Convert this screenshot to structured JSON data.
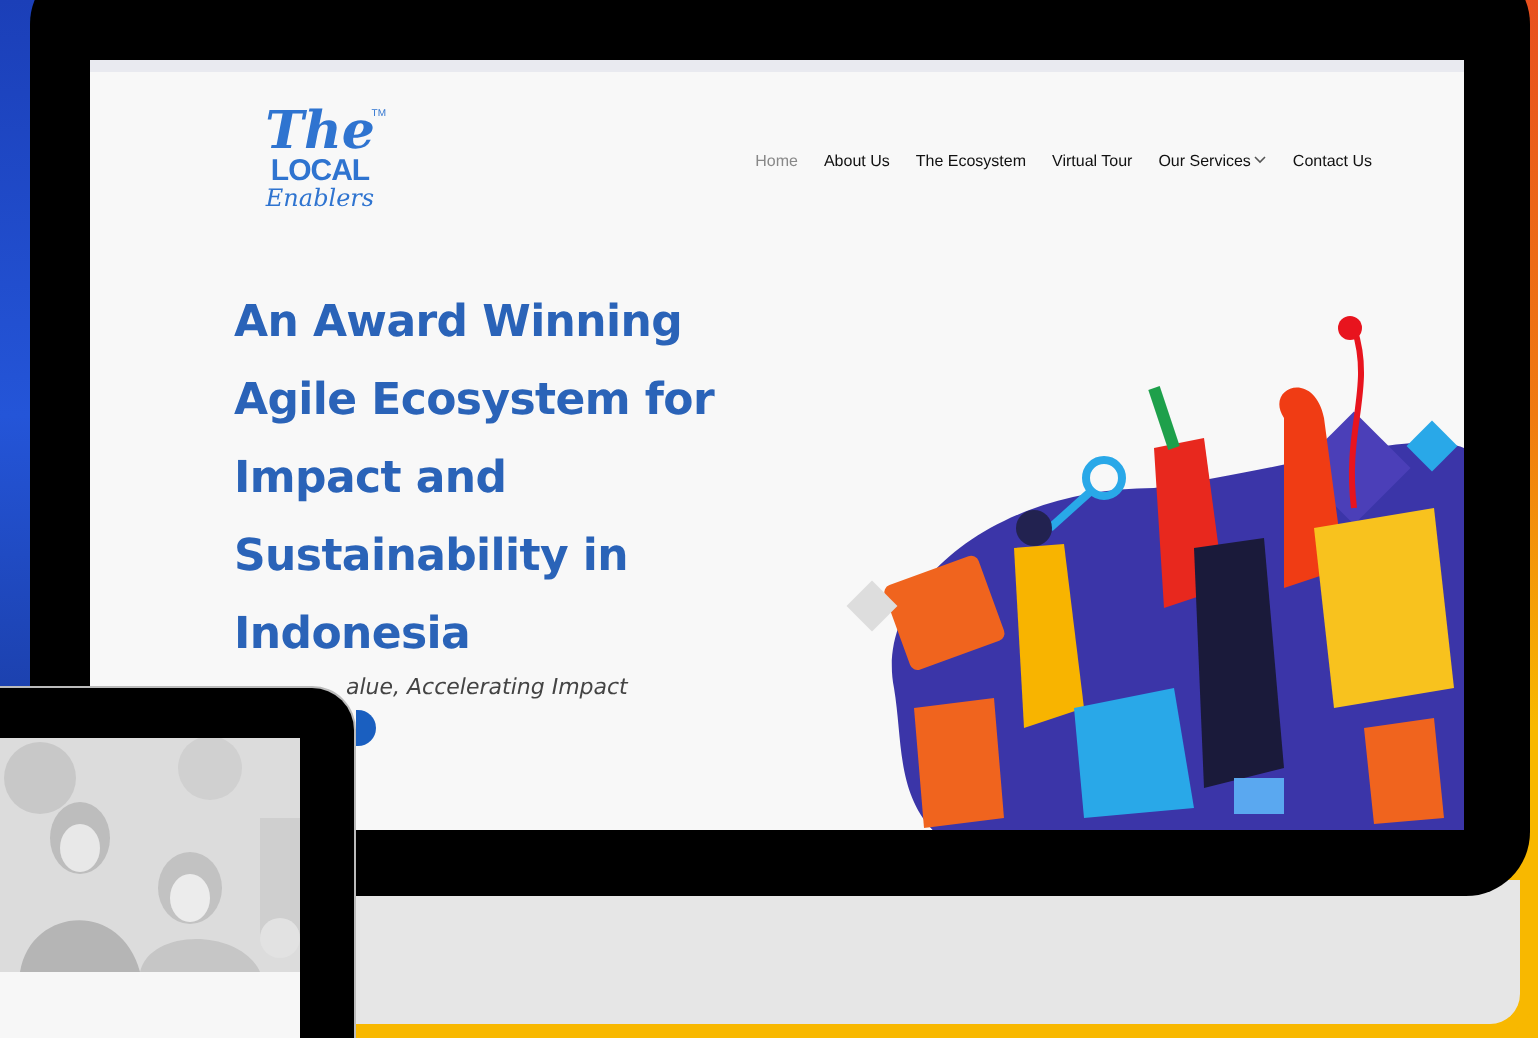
{
  "logo": {
    "line_1": "The",
    "line_2": "LOCAL",
    "line_3": "Enablers",
    "mark": "TM"
  },
  "nav": [
    {
      "label": "Home",
      "selected": true,
      "dropdown": false
    },
    {
      "label": "About Us",
      "selected": false,
      "dropdown": false
    },
    {
      "label": "The Ecosystem",
      "selected": false,
      "dropdown": false
    },
    {
      "label": "Virtual Tour",
      "selected": false,
      "dropdown": false
    },
    {
      "label": "Our Services",
      "selected": false,
      "dropdown": true
    },
    {
      "label": "Contact Us",
      "selected": false,
      "dropdown": false
    }
  ],
  "hero": {
    "heading_lines": [
      "An Award Winning",
      "Agile Ecosystem for",
      "Impact and",
      "Sustainability in",
      "Indonesia"
    ],
    "subtitle": "alue, Accelerating Impact"
  }
}
